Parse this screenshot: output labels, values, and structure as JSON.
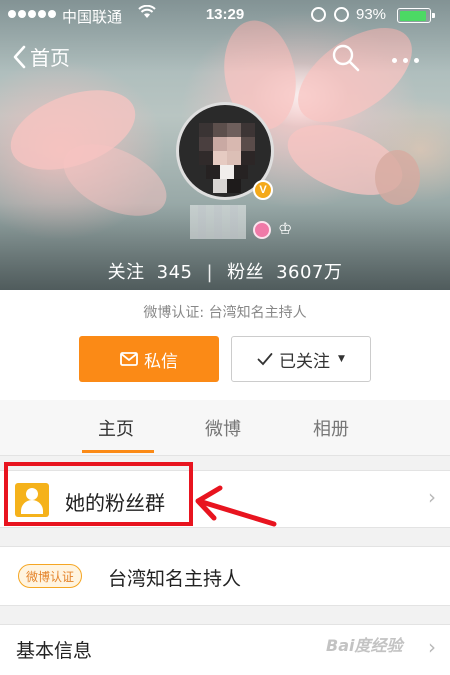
{
  "status_bar": {
    "carrier": "中国联通",
    "time": "13:29",
    "battery_percent": "93%",
    "battery_level": 0.93
  },
  "nav": {
    "back_label": "首页"
  },
  "profile": {
    "following_label": "关注",
    "following_count": "345",
    "followers_label": "粉丝",
    "followers_count": "3607万",
    "verification_line": "微博认证: 台湾知名主持人",
    "verified_badge": "V"
  },
  "actions": {
    "message_label": "私信",
    "followed_label": "已关注"
  },
  "tabs": [
    {
      "label": "主页",
      "active": true
    },
    {
      "label": "微博",
      "active": false
    },
    {
      "label": "相册",
      "active": false
    }
  ],
  "rows": {
    "fan_group_label": "她的粉丝群",
    "verify_badge_label": "微博认证",
    "verify_text": "台湾知名主持人",
    "basic_info_label": "基本信息"
  },
  "watermark": "Bai度经验",
  "colors": {
    "accent_orange": "#fb8a16",
    "highlight_red": "#e8141f",
    "battery_green": "#4cd964"
  }
}
